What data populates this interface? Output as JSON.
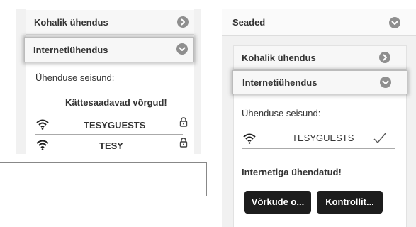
{
  "left_panel": {
    "rows": [
      {
        "label": "Kohalik ühendus"
      },
      {
        "label": "Internetiühendus"
      }
    ],
    "status_label": "Ühenduse seisund:",
    "networks_heading": "Kättesaadavad võrgud!",
    "networks": [
      {
        "ssid": "TESYGUESTS",
        "icon": "wifi-icon",
        "secured": true
      },
      {
        "ssid": "TESY",
        "icon": "wifi-icon",
        "secured": true
      }
    ]
  },
  "right_panel": {
    "header_label": "Seaded",
    "rows": [
      {
        "label": "Kohalik ühendus"
      },
      {
        "label": "Internetiühendus"
      }
    ],
    "status_label": "Ühenduse seisund:",
    "connected_network": {
      "ssid": "TESYGUESTS",
      "icon": "wifi-icon",
      "status_icon": "checkmark-icon"
    },
    "connected_message": "Internetiga ühendatud!",
    "buttons": [
      {
        "label": "Võrkude o..."
      },
      {
        "label": "Kontrollit..."
      }
    ]
  },
  "colors": {
    "panel_bg": "#f1f1f1",
    "circle_icon": "#8f8f8f",
    "button_bg": "#1d1d1d"
  }
}
